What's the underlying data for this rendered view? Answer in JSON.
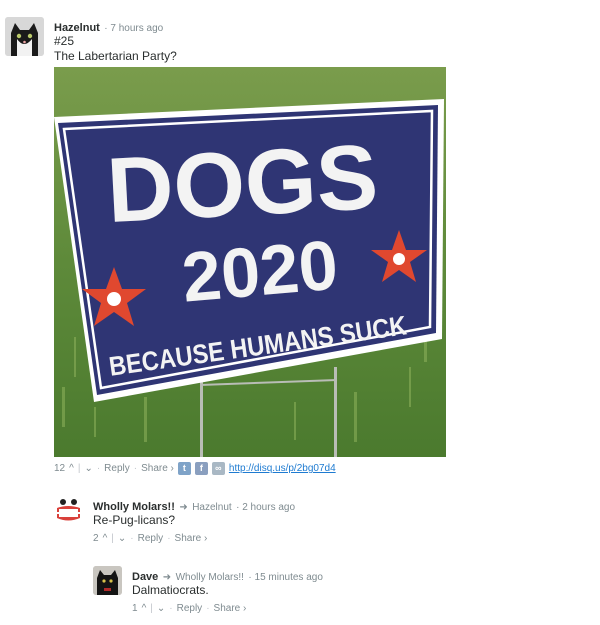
{
  "comments": [
    {
      "author": "Hazelnut",
      "time": "7 hours ago",
      "lines": [
        "#25",
        "The Labertarian Party?"
      ],
      "sign": {
        "line1": "DOGS",
        "line2": "2020",
        "line3": "BECAUSE HUMANS SUCK"
      },
      "votes": "12",
      "reply": "Reply",
      "share": "Share ›",
      "link": "http://disq.us/p/2bg07d4"
    },
    {
      "author": "Wholly Molars!!",
      "reply_to": "Hazelnut",
      "time": "2 hours ago",
      "text": "Re-Pug-licans?",
      "votes": "2",
      "reply": "Reply",
      "share": "Share ›"
    },
    {
      "author": "Dave",
      "reply_to": "Wholly Molars!!",
      "time": "15 minutes ago",
      "text": "Dalmatiocrats.",
      "votes": "1",
      "reply": "Reply",
      "share": "Share ›"
    }
  ],
  "icons": {
    "twitter": "twitter-icon",
    "facebook": "facebook-icon",
    "link": "link-icon"
  }
}
